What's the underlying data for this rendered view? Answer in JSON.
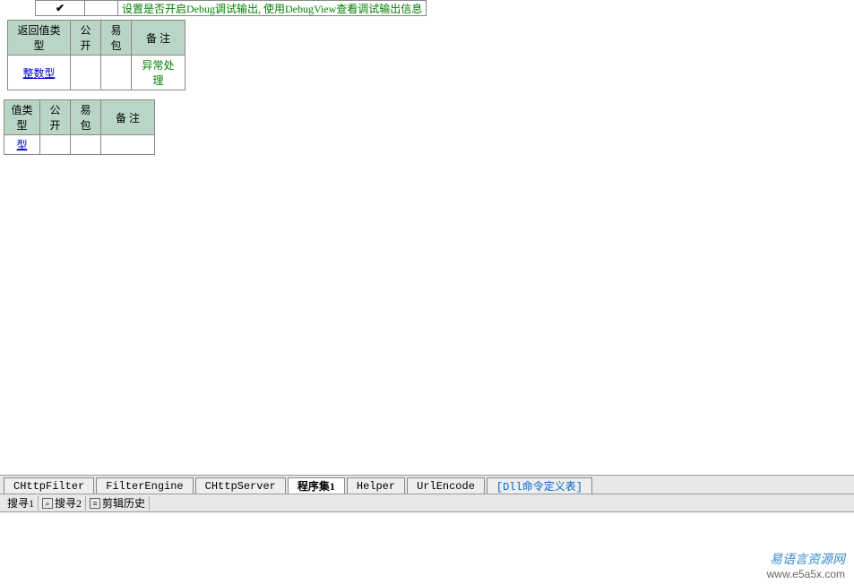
{
  "description_row": {
    "check": "✔",
    "text": "设置是否开启Debug调试输出, 使用DebugView查看调试输出信息"
  },
  "table1": {
    "headers": [
      "返回值类型",
      "公开",
      "易包",
      "备 注"
    ],
    "rows": [
      {
        "type": "整数型",
        "public": "",
        "package": "",
        "note": "异常处理"
      }
    ]
  },
  "table2": {
    "headers": [
      "值类型",
      "公开",
      "易包",
      "备 注"
    ],
    "rows": [
      {
        "type": "型",
        "public": "",
        "package": "",
        "note": ""
      }
    ]
  },
  "tabs": [
    {
      "label": "CHttpFilter",
      "active": false,
      "special": false
    },
    {
      "label": "FilterEngine",
      "active": false,
      "special": false
    },
    {
      "label": "CHttpServer",
      "active": false,
      "special": false
    },
    {
      "label": "程序集1",
      "active": true,
      "special": false
    },
    {
      "label": "Helper",
      "active": false,
      "special": false
    },
    {
      "label": "UrlEncode",
      "active": false,
      "special": false
    },
    {
      "label": "[Dll命令定义表]",
      "active": false,
      "special": true
    }
  ],
  "search_bar": {
    "items": [
      {
        "icon": "",
        "label": "搜寻1"
      },
      {
        "icon": "🔍",
        "label": "搜寻2"
      },
      {
        "icon": "📋",
        "label": "剪辑历史"
      }
    ]
  },
  "watermark": {
    "title": "易语言资源网",
    "url": "www.e5a5x.com"
  }
}
